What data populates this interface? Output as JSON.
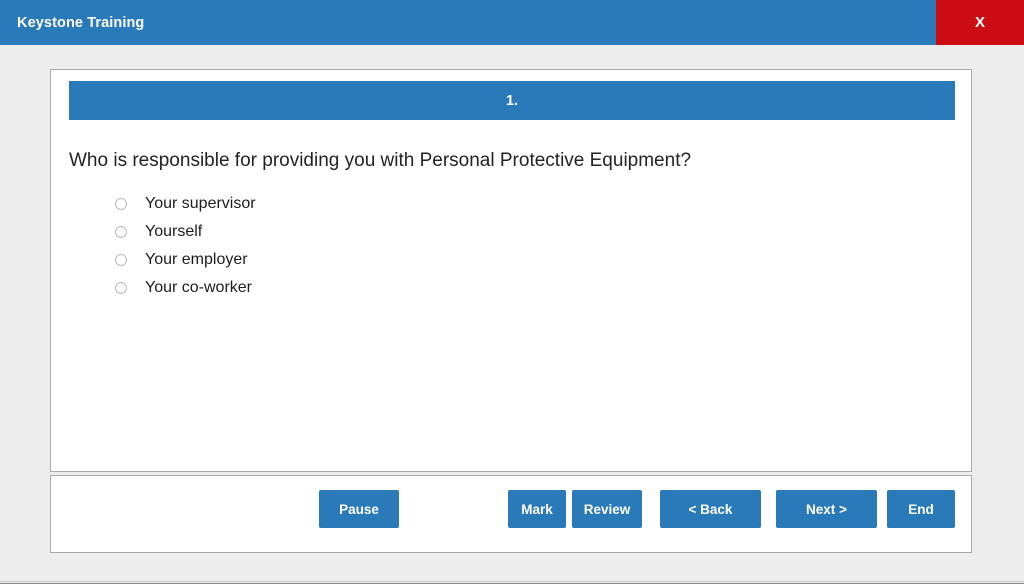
{
  "titlebar": {
    "app_title": "Keystone Training",
    "close_label": "X",
    "background_color": "#2a7ab9",
    "close_color": "#cc0d16"
  },
  "question": {
    "number_label": "1.",
    "text": "Who is responsible for providing you with Personal Protective Equipment?",
    "options": [
      {
        "label": "Your supervisor",
        "selected": false
      },
      {
        "label": "Yourself",
        "selected": false
      },
      {
        "label": "Your employer",
        "selected": false
      },
      {
        "label": "Your co-worker",
        "selected": false
      }
    ]
  },
  "footer": {
    "pause_label": "Pause",
    "mark_label": "Mark",
    "review_label": "Review",
    "back_label": "< Back",
    "next_label": "Next >",
    "end_label": "End",
    "button_color": "#2a7ab9"
  }
}
